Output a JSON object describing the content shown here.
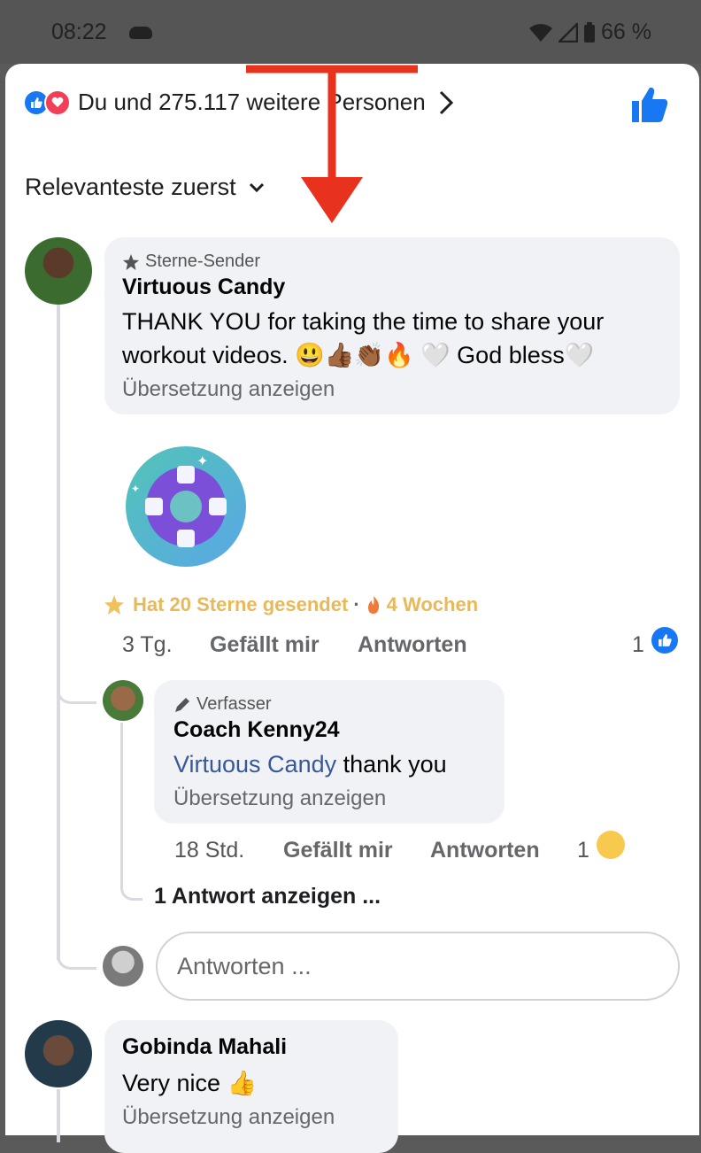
{
  "status_bar": {
    "time": "08:22",
    "battery": "66 %"
  },
  "reactions": {
    "text": "Du und 275.117 weitere Personen"
  },
  "sort": {
    "label": "Relevanteste zuerst"
  },
  "comments": [
    {
      "badge": "Sterne-Sender",
      "author": "Virtuous Candy",
      "text_line1": "THANK YOU for taking the time to share your",
      "text_line2": "workout videos. 😃👍🏾👏🏾🔥 🤍 God bless🤍",
      "translate": "Übersetzung anzeigen",
      "stars_text": "Hat 20 Sterne gesendet",
      "separator": "·",
      "weeks_text": "4 Wochen",
      "time": "3 Tg.",
      "like_label": "Gefällt mir",
      "reply_label": "Antworten",
      "reaction_count": "1"
    },
    {
      "badge": "Verfasser",
      "author": "Coach Kenny24",
      "mention": "Virtuous Candy",
      "text": " thank you",
      "translate": "Übersetzung anzeigen",
      "time": "18 Std.",
      "like_label": "Gefällt mir",
      "reply_label": "Antworten",
      "reaction_count": "1",
      "more_replies": "1 Antwort anzeigen ..."
    },
    {
      "author": "Gobinda Mahali",
      "text": "Very nice 👍",
      "translate": "Übersetzung anzeigen"
    }
  ],
  "reply_box": {
    "placeholder": "Antworten ..."
  },
  "icons": {
    "cloud": "cloud-icon",
    "wifi": "wifi-icon",
    "signal": "signal-icon",
    "battery": "battery-icon",
    "like": "like-icon",
    "love": "love-icon",
    "thumbs_up": "thumbs-up-icon",
    "chevron_right": "chevron-right-icon",
    "chevron_down": "chevron-down-icon",
    "star": "star-icon",
    "pencil": "pencil-icon",
    "fire": "fire-icon",
    "lifebuoy": "lifebuoy-sticker-icon"
  },
  "colors": {
    "brand_blue": "#1877f2",
    "love_red": "#f33e58",
    "annotation_red": "#e8321e",
    "stars_gold": "#e8b95a"
  }
}
